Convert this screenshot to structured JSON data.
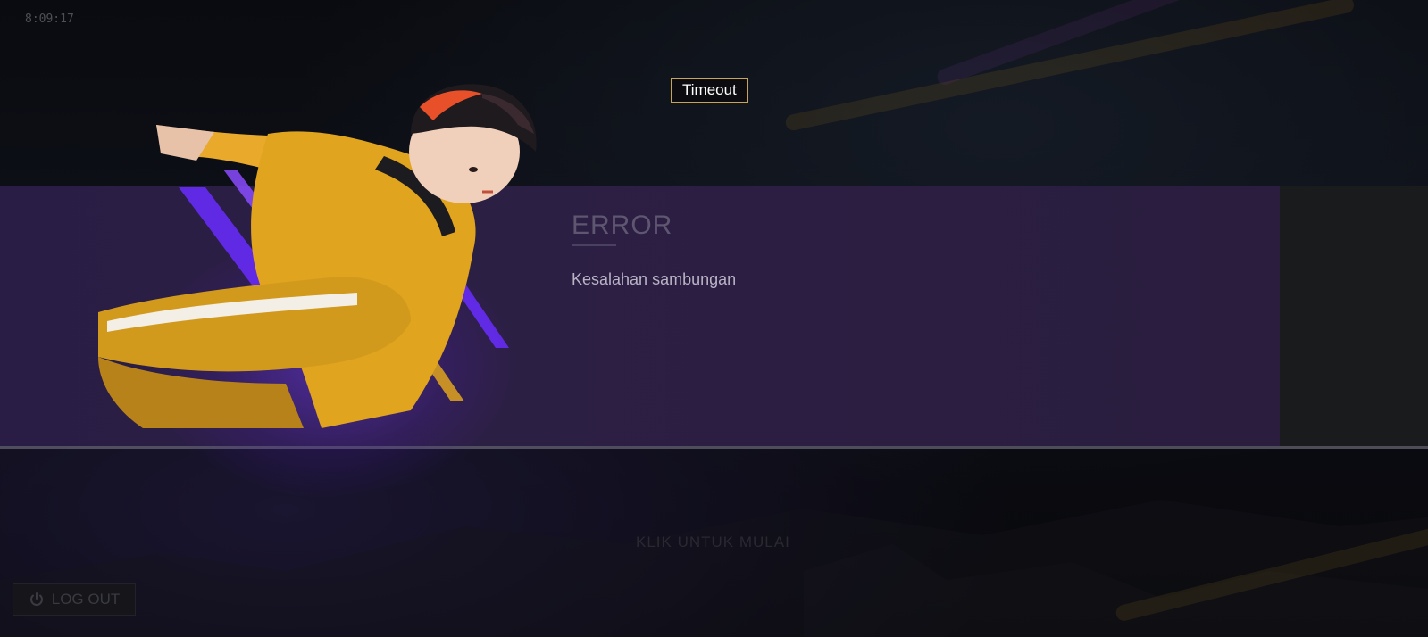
{
  "status_bar": {
    "time": "8:09:17"
  },
  "toast": {
    "label": "Timeout"
  },
  "dialog": {
    "title": "ERROR",
    "message": "Kesalahan sambungan"
  },
  "background_screen": {
    "hidden_button_label": "KLIK UNTUK MULAI",
    "logout_label": "LOG OUT"
  },
  "colors": {
    "dialog_bg": "#2c1f44",
    "accent_gold": "#c6a45a",
    "character_yellow": "#e0a41e",
    "glow_purple": "#7a3cff"
  },
  "icons": {
    "logout": "power-icon"
  }
}
